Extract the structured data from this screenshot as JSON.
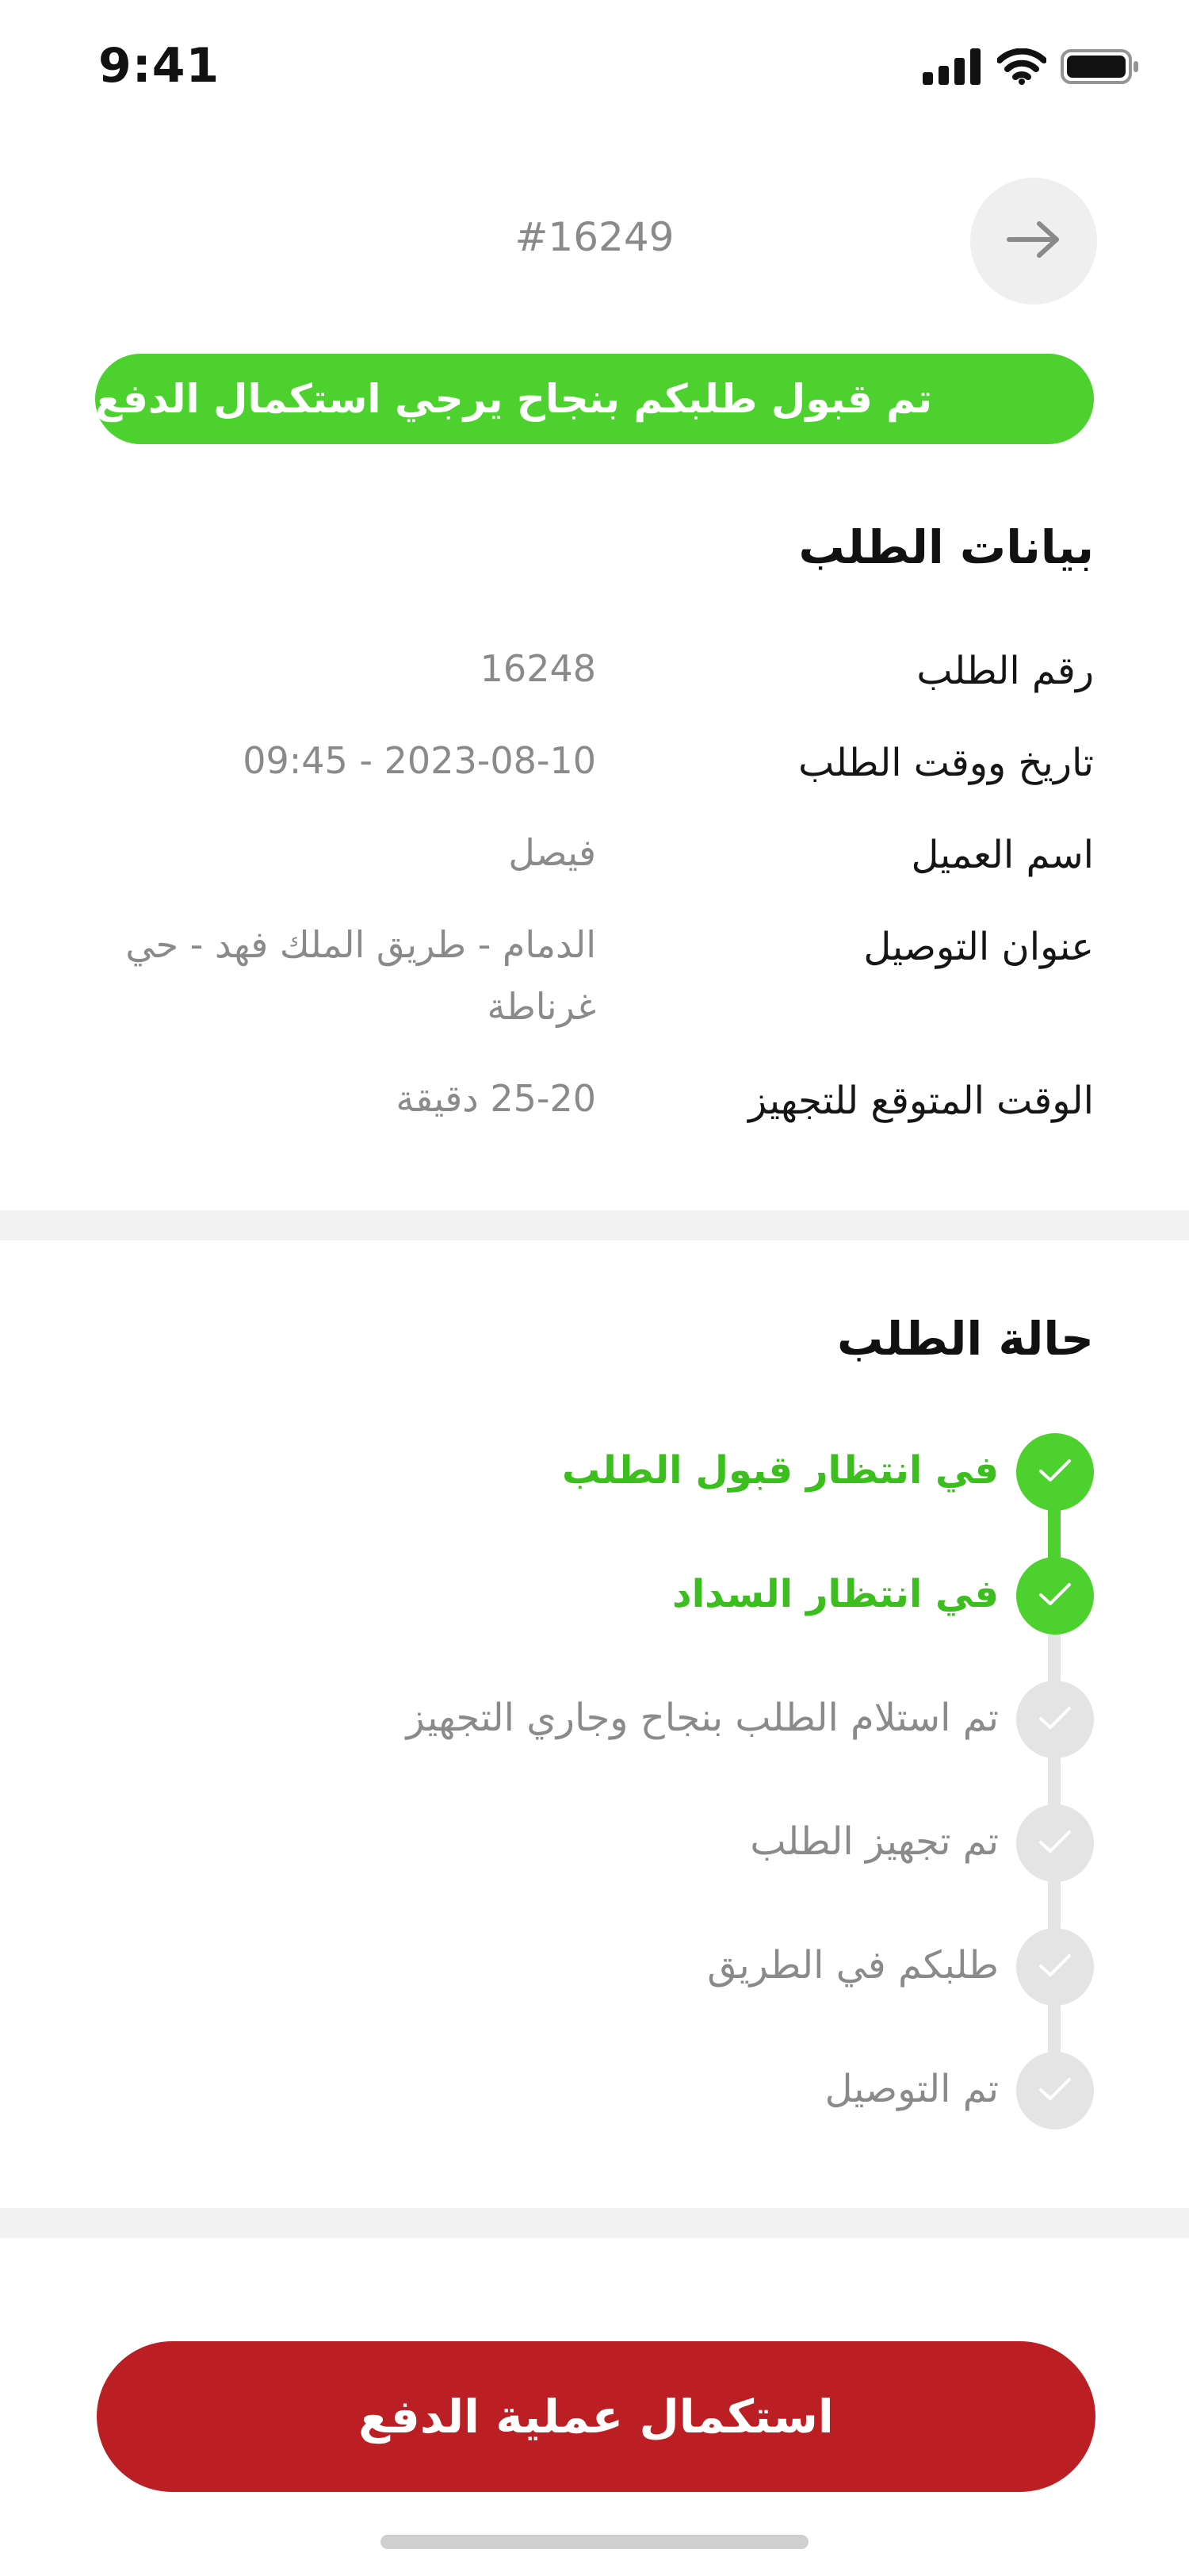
{
  "status_bar": {
    "time": "9:41"
  },
  "header": {
    "order_id": "#16249"
  },
  "banner": {
    "text": "تم قبول طلبكم بنجاح يرجي استكمال الدفع",
    "color": "#4cd12e"
  },
  "order_details": {
    "title": "بيانات الطلب",
    "rows": [
      {
        "label": "رقم الطلب",
        "value": "16248"
      },
      {
        "label": "تاريخ ووقت الطلب",
        "value": "2023-08-10 - 09:45"
      },
      {
        "label": "اسم العميل",
        "value": "فيصل"
      },
      {
        "label": "عنوان التوصيل",
        "value": "الدمام - طريق الملك فهد - حي غرناطة"
      },
      {
        "label": "الوقت المتوقع للتجهيز",
        "value": "25-20 دقيقة"
      }
    ]
  },
  "order_status": {
    "title": "حالة الطلب",
    "steps": [
      {
        "label": "في انتظار قبول الطلب",
        "state": "done"
      },
      {
        "label": "في انتظار السداد",
        "state": "done"
      },
      {
        "label": "تم استلام الطلب بنجاح وجاري التجهيز",
        "state": "pending"
      },
      {
        "label": "تم تجهيز الطلب",
        "state": "pending"
      },
      {
        "label": "طلبكم في الطريق",
        "state": "pending"
      },
      {
        "label": "تم التوصيل",
        "state": "pending"
      }
    ]
  },
  "cta": {
    "label": "استكمال عملية الدفع",
    "color": "#bb1f23"
  },
  "icons": {
    "back": "arrow-right-icon",
    "check": "checkmark-icon",
    "signal": "cellular-signal-icon",
    "wifi": "wifi-icon",
    "battery": "battery-icon"
  }
}
